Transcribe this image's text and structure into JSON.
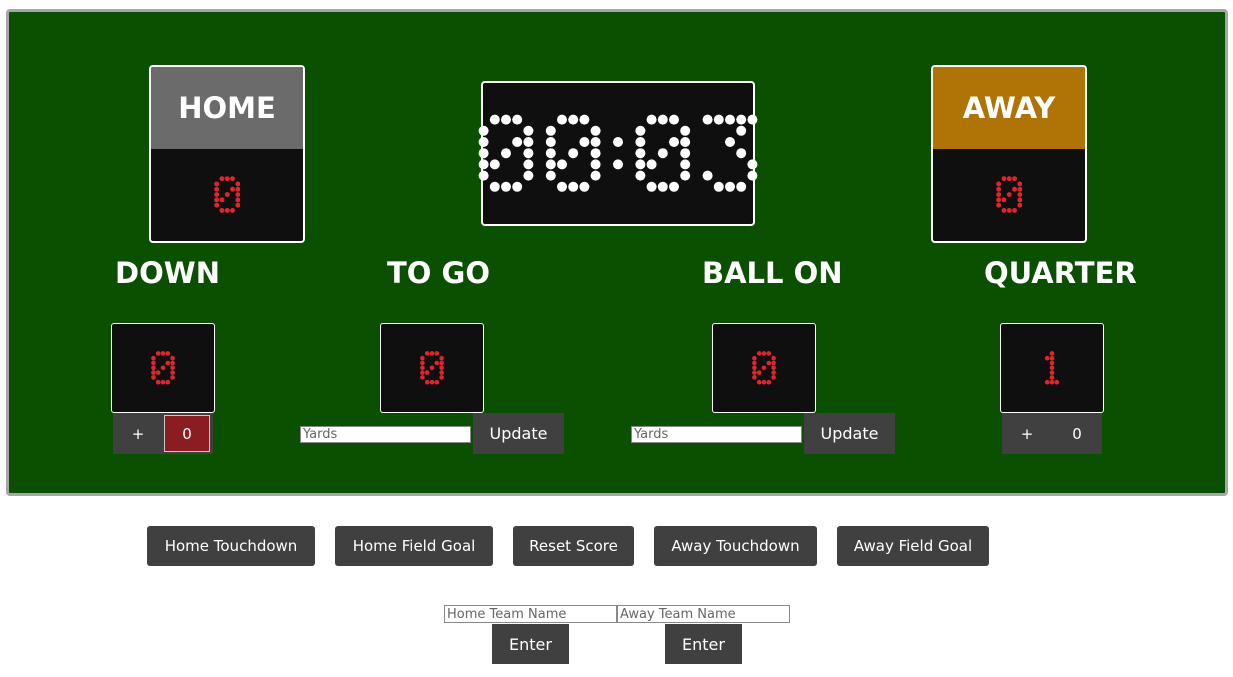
{
  "home": {
    "name": "HOME",
    "score": "0",
    "header_color": "#6b6b6b"
  },
  "away": {
    "name": "AWAY",
    "score": "0",
    "header_color": "#b07406"
  },
  "clock": {
    "time": "00:03"
  },
  "labels": {
    "down": "DOWN",
    "to_go": "TO GO",
    "ball_on": "BALL ON",
    "quarter": "QUARTER"
  },
  "down": {
    "value": "0",
    "plus_label": "+",
    "counter": "0"
  },
  "to_go": {
    "value": "0",
    "placeholder": "Yards",
    "button": "Update"
  },
  "ball_on": {
    "value": "0",
    "placeholder": "Yards",
    "button": "Update"
  },
  "quarter": {
    "value": "1",
    "plus_label": "+",
    "counter": "0"
  },
  "actions": {
    "home_touchdown": "Home Touchdown",
    "home_field_goal": "Home Field Goal",
    "reset_score": "Reset Score",
    "away_touchdown": "Away Touchdown",
    "away_field_goal": "Away Field Goal"
  },
  "team_names": {
    "home_placeholder": "Home Team Name",
    "away_placeholder": "Away Team Name",
    "home_enter": "Enter",
    "away_enter": "Enter"
  },
  "colors": {
    "board": "#0a5000",
    "led_red": "#e0262c",
    "led_white": "#ffffff",
    "button": "#404040"
  }
}
